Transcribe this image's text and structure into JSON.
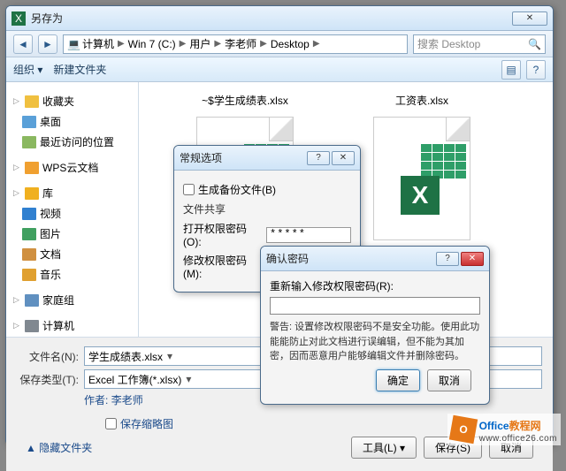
{
  "window": {
    "title": "另存为"
  },
  "nav": {
    "segments": [
      "计算机",
      "Win 7 (C:)",
      "用户",
      "李老师",
      "Desktop"
    ],
    "search_placeholder": "搜索 Desktop"
  },
  "toolbar": {
    "organize": "组织 ▾",
    "newfolder": "新建文件夹"
  },
  "sidebar": {
    "fav_group": "收藏夹",
    "items_fav": [
      "桌面",
      "最近访问的位置"
    ],
    "wps": "WPS云文档",
    "lib_group": "库",
    "items_lib": [
      "视频",
      "图片",
      "文档",
      "音乐"
    ],
    "home": "家庭组",
    "computer": "计算机"
  },
  "files": {
    "a": "~$学生成绩表.xlsx",
    "b": "工资表.xlsx"
  },
  "form": {
    "name_label": "文件名(N):",
    "name_value": "学生成绩表.xlsx",
    "type_label": "保存类型(T):",
    "type_value": "Excel 工作簿(*.xlsx)",
    "author_label": "作者:",
    "author_value": "李老师",
    "thumb_cb": "保存缩略图",
    "hide_folders": "隐藏文件夹",
    "tools": "工具(L)",
    "save": "保存(S)",
    "cancel": "取消"
  },
  "opt": {
    "title": "常规选项",
    "backup_cb": "生成备份文件(B)",
    "share_section": "文件共享",
    "open_pw": "打开权限密码(O):",
    "modify_pw": "修改权限密码(M):",
    "pw_mask": "*****"
  },
  "confirm": {
    "title": "确认密码",
    "prompt": "重新输入修改权限密码(R):",
    "warn": "警告: 设置修改权限密码不是安全功能。使用此功能能防止对此文档进行误编辑，但不能为其加密，因而恶意用户能够编辑文件并删除密码。",
    "ok": "确定",
    "cancel": "取消"
  },
  "watermark": {
    "brand1": "Office",
    "brand2": "教程网",
    "url": "www.office26.com"
  }
}
